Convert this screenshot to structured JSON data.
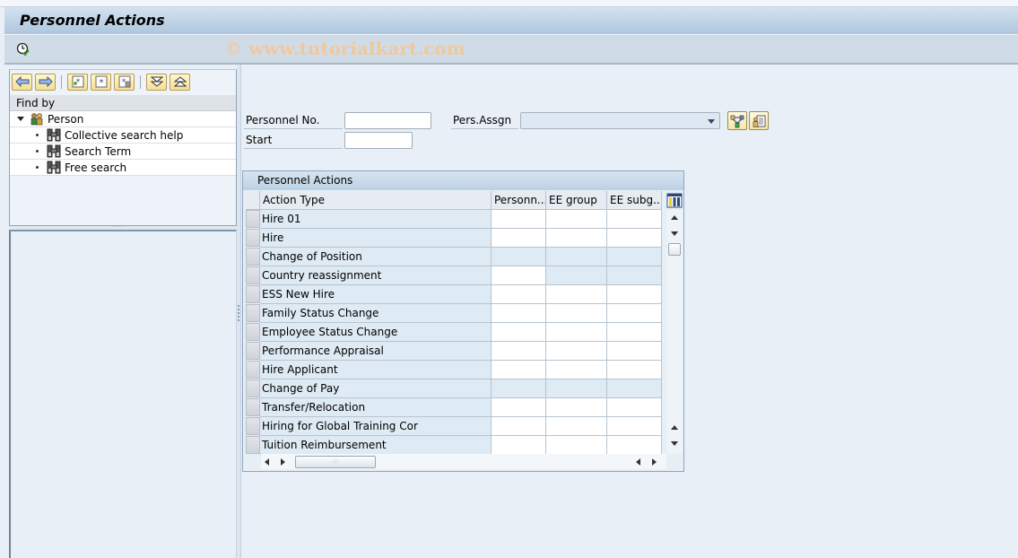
{
  "window": {
    "title": "Personnel Actions",
    "watermark": "© www.tutorialkart.com"
  },
  "toolbar": {
    "execute_icon": "clock-execute-icon"
  },
  "navigator": {
    "toolbar_buttons": [
      {
        "name": "back-button",
        "icon": "arrow-left-icon"
      },
      {
        "name": "forward-button",
        "icon": "arrow-right-icon"
      },
      {
        "name": "new-search-button",
        "icon": "new-asterisk-icon"
      },
      {
        "name": "search-variant-button",
        "icon": "asterisk-icon"
      },
      {
        "name": "delete-search-button",
        "icon": "delete-asterisk-icon"
      },
      {
        "name": "expand-all-button",
        "icon": "expand-icon"
      },
      {
        "name": "collapse-all-button",
        "icon": "collapse-icon"
      }
    ],
    "find_by_label": "Find by",
    "tree": {
      "root": "Person",
      "children": [
        "Collective search help",
        "Search Term",
        "Free search"
      ]
    }
  },
  "form": {
    "personnel_no_label": "Personnel No.",
    "personnel_no_value": "",
    "start_label": "Start",
    "start_value": "",
    "pers_assgn_label": "Pers.Assgn",
    "pers_assgn_value": ""
  },
  "actions_grid": {
    "title": "Personnel Actions",
    "columns": [
      "Action Type",
      "Personn...",
      "EE group",
      "EE subg..."
    ],
    "rows": [
      {
        "action": "Hire 01",
        "cells": [
          "in",
          "in",
          "in"
        ]
      },
      {
        "action": "Hire",
        "cells": [
          "in",
          "in",
          "in"
        ]
      },
      {
        "action": "Change of Position",
        "cells": [
          "ro",
          "ro",
          "ro"
        ]
      },
      {
        "action": "Country reassignment",
        "cells": [
          "in",
          "ro",
          "ro"
        ]
      },
      {
        "action": "ESS New Hire",
        "cells": [
          "in",
          "in",
          "in"
        ]
      },
      {
        "action": "Family Status Change",
        "cells": [
          "in",
          "in",
          "in"
        ]
      },
      {
        "action": "Employee Status Change",
        "cells": [
          "in",
          "in",
          "in"
        ]
      },
      {
        "action": "Performance Appraisal",
        "cells": [
          "in",
          "in",
          "in"
        ]
      },
      {
        "action": "Hire Applicant",
        "cells": [
          "in",
          "in",
          "in"
        ]
      },
      {
        "action": "Change of Pay",
        "cells": [
          "ro",
          "ro",
          "ro"
        ]
      },
      {
        "action": "Transfer/Relocation",
        "cells": [
          "in",
          "in",
          "in"
        ]
      },
      {
        "action": "Hiring for Global Training Cor",
        "cells": [
          "in",
          "in",
          "in"
        ]
      },
      {
        "action": "Tuition Reimbursement",
        "cells": [
          "in",
          "in",
          "in"
        ]
      }
    ]
  }
}
